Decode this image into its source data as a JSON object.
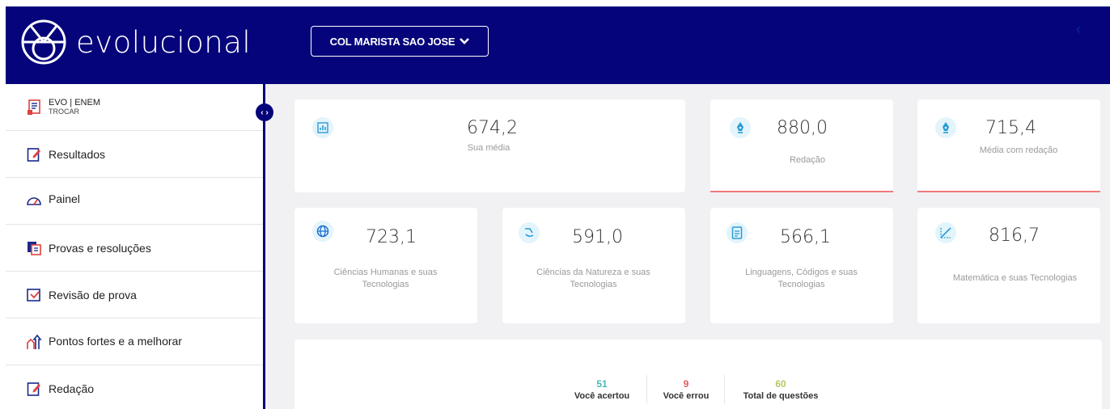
{
  "header": {
    "logo_text": "evolucional",
    "school_label": "COL MARISTA SAO JOSE",
    "collapse_glyph": "‹"
  },
  "sidebar": {
    "toggle_glyph": "‹ ›",
    "exam": {
      "title": "EVO | ENEM",
      "sub": "TROCAR"
    },
    "items": [
      {
        "label": "Resultados",
        "icon": "results-icon"
      },
      {
        "label": "Painel",
        "icon": "gauge-icon"
      },
      {
        "label": "Provas e resoluções",
        "icon": "tests-icon"
      },
      {
        "label": "Revisão de prova",
        "icon": "review-icon"
      },
      {
        "label": "Pontos fortes e a melhorar",
        "icon": "strengths-icon"
      },
      {
        "label": "Redação",
        "icon": "essay-icon"
      }
    ]
  },
  "summary": {
    "average": {
      "value": "674,2",
      "label": "Sua média"
    },
    "essay": {
      "value": "880,0",
      "label": "Redação"
    },
    "with_essay": {
      "value": "715,4",
      "label": "Média com redação"
    }
  },
  "areas": [
    {
      "value": "723,1",
      "label": "Ciências Humanas e suas Tecnologias",
      "icon": "globe-icon"
    },
    {
      "value": "591,0",
      "label": "Ciências da Natureza e suas Tecnologias",
      "icon": "microscope-icon"
    },
    {
      "value": "566,1",
      "label": "Linguagens, Códigos e suas Tecnologias",
      "icon": "document-icon"
    },
    {
      "value": "816,7",
      "label": "Matemática e suas Tecnologias",
      "icon": "math-icon"
    }
  ],
  "stats": {
    "correct": {
      "value": "51",
      "label": "Você acertou"
    },
    "wrong": {
      "value": "9",
      "label": "Você errou"
    },
    "total": {
      "value": "60",
      "label": "Total de questões"
    }
  },
  "colors": {
    "brand": "#05047a",
    "correct": "#4bb8b0",
    "wrong": "#e55b5b",
    "total": "#b7c764",
    "highlight_line": "#f07a7a"
  }
}
